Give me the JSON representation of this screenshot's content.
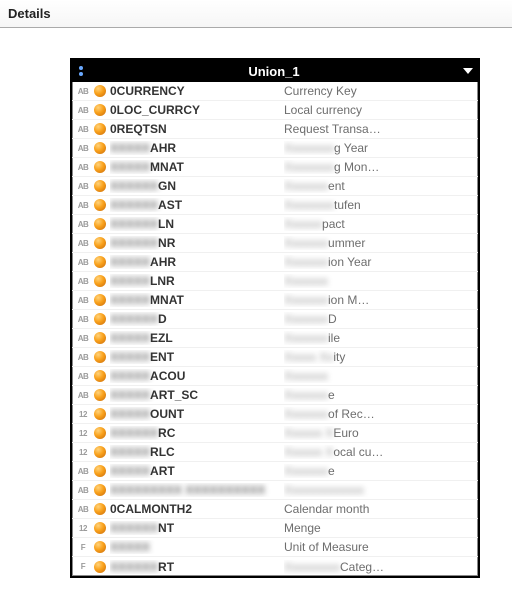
{
  "header": {
    "title": "Details"
  },
  "table": {
    "title": "Union_1"
  },
  "type_labels": {
    "ab": "AB",
    "num": "12",
    "f": "F"
  },
  "rows": [
    {
      "type": "ab",
      "name_pre": "",
      "name_blur": "",
      "name_post": "0CURRENCY",
      "desc_pre": "Currency Key",
      "desc_blur": "",
      "desc_post": ""
    },
    {
      "type": "ab",
      "name_pre": "",
      "name_blur": "",
      "name_post": "0LOC_CURRCY",
      "desc_pre": "Local currency",
      "desc_blur": "",
      "desc_post": ""
    },
    {
      "type": "ab",
      "name_pre": "",
      "name_blur": "",
      "name_post": "0REQTSN",
      "desc_pre": "Request Transa…",
      "desc_blur": "",
      "desc_post": ""
    },
    {
      "type": "ab",
      "name_pre": "",
      "name_blur": "XXXXX",
      "name_post": "AHR",
      "desc_pre": "",
      "desc_blur": "Xxxxxxxx",
      "desc_post": "g Year"
    },
    {
      "type": "ab",
      "name_pre": "",
      "name_blur": "XXXXX",
      "name_post": "MNAT",
      "desc_pre": "",
      "desc_blur": "Xxxxxxxx",
      "desc_post": "g Mon…"
    },
    {
      "type": "ab",
      "name_pre": "",
      "name_blur": "XXXXXX",
      "name_post": "GN",
      "desc_pre": "",
      "desc_blur": "Xxxxxxx",
      "desc_post": "ent"
    },
    {
      "type": "ab",
      "name_pre": "",
      "name_blur": "XXXXXX",
      "name_post": "AST",
      "desc_pre": "",
      "desc_blur": "Xxxxxxxx",
      "desc_post": "tufen"
    },
    {
      "type": "ab",
      "name_pre": "",
      "name_blur": "XXXXXX",
      "name_post": "LN",
      "desc_pre": "",
      "desc_blur": "Xxxxxx",
      "desc_post": "pact"
    },
    {
      "type": "ab",
      "name_pre": "",
      "name_blur": "XXXXXX",
      "name_post": "NR",
      "desc_pre": "",
      "desc_blur": "Xxxxxxx",
      "desc_post": "ummer"
    },
    {
      "type": "ab",
      "name_pre": "",
      "name_blur": "XXXXX",
      "name_post": "AHR",
      "desc_pre": "",
      "desc_blur": "Xxxxxxx",
      "desc_post": "ion Year"
    },
    {
      "type": "ab",
      "name_pre": "",
      "name_blur": "XXXXX",
      "name_post": "LNR",
      "desc_pre": "",
      "desc_blur": "Xxxxxxx",
      "desc_post": ""
    },
    {
      "type": "ab",
      "name_pre": "",
      "name_blur": "XXXXX",
      "name_post": "MNAT",
      "desc_pre": "",
      "desc_blur": "Xxxxxxx",
      "desc_post": "ion M…"
    },
    {
      "type": "ab",
      "name_pre": "",
      "name_blur": "XXXXXX",
      "name_post": "D",
      "desc_pre": "",
      "desc_blur": "Xxxxxxx",
      "desc_post": "D"
    },
    {
      "type": "ab",
      "name_pre": "",
      "name_blur": "XXXXX",
      "name_post": "EZL",
      "desc_pre": "",
      "desc_blur": "Xxxxxxx",
      "desc_post": "ile"
    },
    {
      "type": "ab",
      "name_pre": "",
      "name_blur": "XXXXX",
      "name_post": "ENT",
      "desc_pre": "",
      "desc_blur": "Xxxxx Xx",
      "desc_post": "ity"
    },
    {
      "type": "ab",
      "name_pre": "",
      "name_blur": "XXXXX",
      "name_post": "ACOU",
      "desc_pre": "",
      "desc_blur": "Xxxxxxx",
      "desc_post": ""
    },
    {
      "type": "ab",
      "name_pre": "",
      "name_blur": "XXXXX",
      "name_post": "ART_SC",
      "desc_pre": "",
      "desc_blur": "Xxxxxxx",
      "desc_post": "e"
    },
    {
      "type": "num",
      "name_pre": "",
      "name_blur": "XXXXX",
      "name_post": "OUNT",
      "desc_pre": "",
      "desc_blur": "Xxxxxxx",
      "desc_post": "of Rec…"
    },
    {
      "type": "num",
      "name_pre": "",
      "name_blur": "XXXXXX",
      "name_post": "RC",
      "desc_pre": "",
      "desc_blur": "Xxxxxx X",
      "desc_post": "Euro"
    },
    {
      "type": "num",
      "name_pre": "",
      "name_blur": "XXXXX",
      "name_post": "RLC",
      "desc_pre": "",
      "desc_blur": "Xxxxxx X",
      "desc_post": "ocal cu…"
    },
    {
      "type": "ab",
      "name_pre": "",
      "name_blur": "XXXXX",
      "name_post": "ART",
      "desc_pre": "",
      "desc_blur": "Xxxxxxx",
      "desc_post": "e"
    },
    {
      "type": "ab",
      "name_pre": "",
      "name_blur": "XXXXXXXXX XXXXXXXXXX",
      "name_post": "",
      "desc_pre": "",
      "desc_blur": "Xxxxxxxxxxxxx",
      "desc_post": ""
    },
    {
      "type": "ab",
      "name_pre": "",
      "name_blur": "",
      "name_post": "0CALMONTH2",
      "desc_pre": "Calendar month",
      "desc_blur": "",
      "desc_post": ""
    },
    {
      "type": "num",
      "name_pre": "",
      "name_blur": "XXXXXX",
      "name_post": "NT",
      "desc_pre": "Menge",
      "desc_blur": "",
      "desc_post": ""
    },
    {
      "type": "f",
      "name_pre": "",
      "name_blur": "XXXXX",
      "name_post": "",
      "desc_pre": "Unit of Measure",
      "desc_blur": "",
      "desc_post": ""
    },
    {
      "type": "f",
      "name_pre": "",
      "name_blur": "XXXXXX",
      "name_post": "RT",
      "desc_pre": "",
      "desc_blur": "Xxxxxxxxx",
      "desc_post": "Categ…"
    }
  ]
}
